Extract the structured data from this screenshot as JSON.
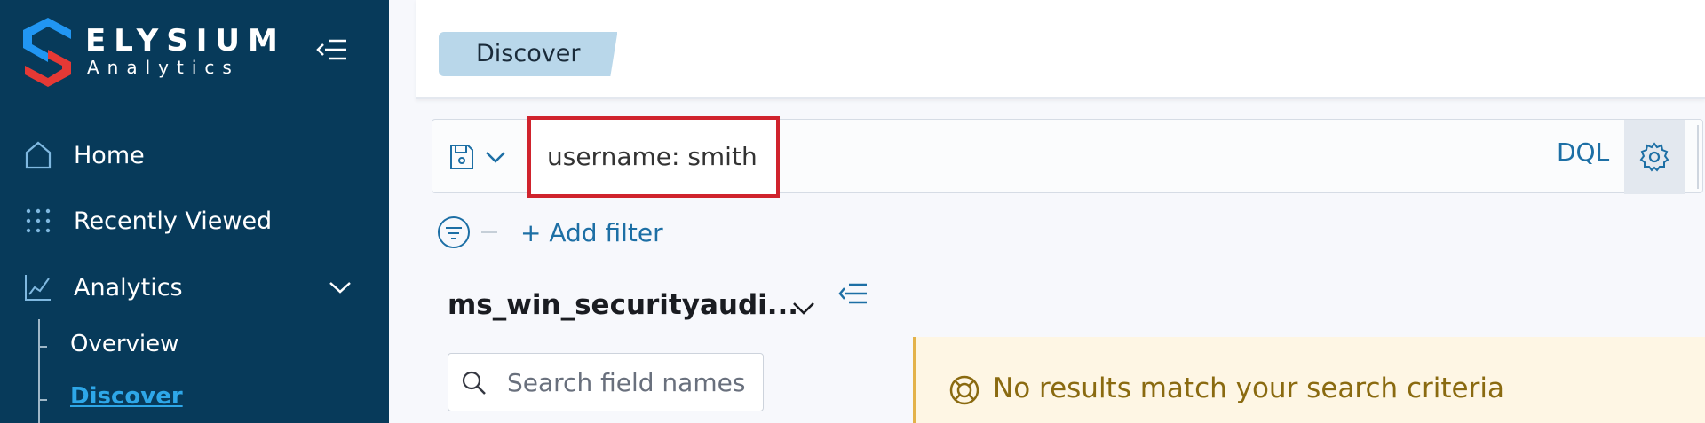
{
  "brand": {
    "name": "ELYSIUM",
    "tagline": "Analytics",
    "colors": {
      "primary": "#073a5a",
      "logo_red": "#e53935",
      "logo_blue": "#2196f3"
    }
  },
  "sidebar": {
    "items": [
      {
        "label": "Home",
        "icon": "home-icon"
      },
      {
        "label": "Recently Viewed",
        "icon": "grid-dots-icon"
      },
      {
        "label": "Analytics",
        "icon": "chart-line-icon",
        "expanded": true
      }
    ],
    "sub_items": [
      {
        "label": "Overview",
        "active": false
      },
      {
        "label": "Discover",
        "active": true
      }
    ]
  },
  "header": {
    "breadcrumb": "Discover"
  },
  "query": {
    "value": "username: smith",
    "language": "DQL"
  },
  "filters": {
    "add_label": "+ Add filter"
  },
  "index_pattern": {
    "name": "ms_win_securityaudi..."
  },
  "field_search": {
    "placeholder": "Search field names"
  },
  "callout": {
    "message": "No results match your search criteria"
  }
}
